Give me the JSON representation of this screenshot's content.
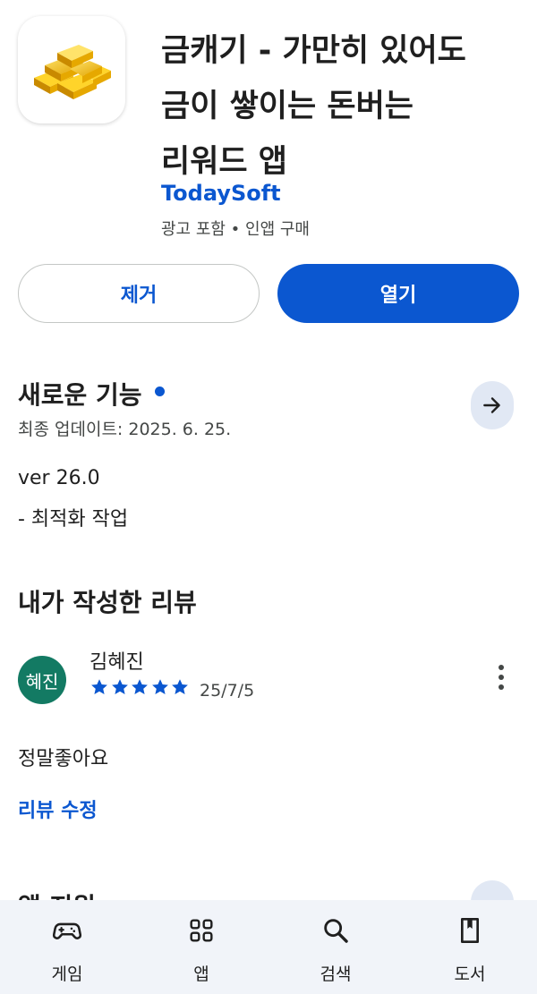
{
  "app": {
    "icon": "gold-bars-icon",
    "title_lines": [
      "금캐기 - 가만히 있어도",
      "금이 쌓이는 돈버는",
      "리워드 앱"
    ],
    "developer": "TodaySoft",
    "meta": "광고 포함 • 인앱 구매"
  },
  "actions": {
    "remove_label": "제거",
    "open_label": "열기"
  },
  "whats_new": {
    "title": "새로운 기능",
    "last_updated": "최종 업데이트: 2025. 6. 25.",
    "notes": [
      "ver 26.0",
      "- 최적화 작업"
    ]
  },
  "my_review": {
    "title": "내가 작성한 리뷰",
    "avatar_text": "혜진",
    "reviewer": "김혜진",
    "rating": 5,
    "date": "25/7/5",
    "text": "정말좋아요",
    "edit_label": "리뷰 수정"
  },
  "next_section": {
    "title_partial": "앱 지원"
  },
  "bottom_nav": [
    {
      "label": "게임",
      "icon": "gamepad-icon"
    },
    {
      "label": "앱",
      "icon": "apps-grid-icon"
    },
    {
      "label": "검색",
      "icon": "search-icon"
    },
    {
      "label": "도서",
      "icon": "book-icon"
    }
  ],
  "colors": {
    "accent": "#0b57d0",
    "avatar_bg": "#137a63",
    "nav_bg": "#f1f4f9"
  }
}
